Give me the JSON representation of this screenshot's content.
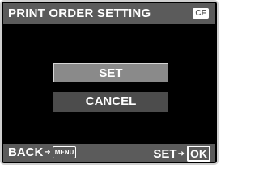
{
  "header": {
    "title": "PRINT ORDER SETTING",
    "card_badge": "CF"
  },
  "menu": {
    "set_label": "SET",
    "cancel_label": "CANCEL"
  },
  "footer": {
    "back_label": "BACK",
    "back_key": "MENU",
    "set_label": "SET",
    "set_key": "OK",
    "arrow_icon": "right-arrow"
  },
  "colors": {
    "background": "#000000",
    "bar": "#5b5b5b",
    "selected": "#8a8a8a",
    "unselected": "#4c4c4c",
    "text": "#ffffff"
  }
}
